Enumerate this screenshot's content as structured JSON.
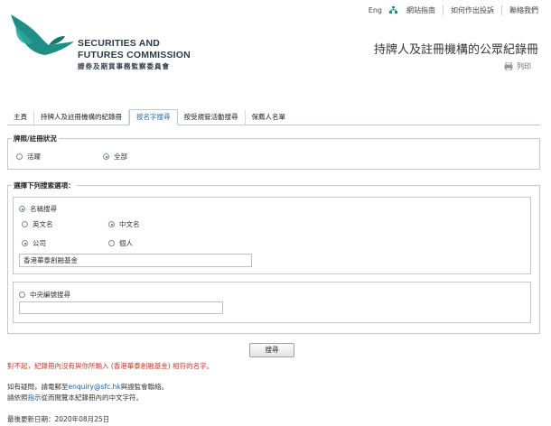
{
  "top_links": {
    "lang": "Eng",
    "sitemap": "網站指南",
    "complaint": "如何作出投訴",
    "contact": "聯絡我們"
  },
  "logo": {
    "line1": "SECURITIES AND",
    "line2": "FUTURES COMMISSION",
    "line3": "證券及期貨事務監察委員會"
  },
  "page_title": "持牌人及註冊機構的公眾紀錄冊",
  "print_label": "列印",
  "tabs": [
    "主頁",
    "持牌人及註冊機構的紀錄冊",
    "按名字搜尋",
    "按受規管活動搜尋",
    "保薦人名單"
  ],
  "license_status": {
    "legend": "牌照/註冊狀況",
    "options": [
      "活躍",
      "全部"
    ],
    "selected": "全部"
  },
  "search_options": {
    "legend": "選擇下列搜索選項：",
    "name_search": "名稱搜尋",
    "english_name": "英文名",
    "chinese_name": "中文名",
    "company": "公司",
    "individual": "個人",
    "name_value": "香港華泰創融基金",
    "ce_search": "中央編號搜尋",
    "ce_value": ""
  },
  "search_button": "搜尋",
  "messages": {
    "error": "對不起，紀錄冊內沒有與你所輸入 (香港華泰創融基金) 相符的名字。",
    "enquiry_prefix": "如有疑問，請電郵至",
    "enquiry_email": "enquiry@sfc.hk",
    "enquiry_suffix": "與證監會聯絡。",
    "guide_prefix": "請依照",
    "guide_link": "指示",
    "guide_suffix": "從而閱覽本紀錄冊內的中文字符。",
    "last_updated": "最後更新日期：2020年08月25日"
  },
  "colors": {
    "brand_teal": "#1f8f86",
    "link": "#1a5fa0",
    "error": "#c0392b"
  }
}
